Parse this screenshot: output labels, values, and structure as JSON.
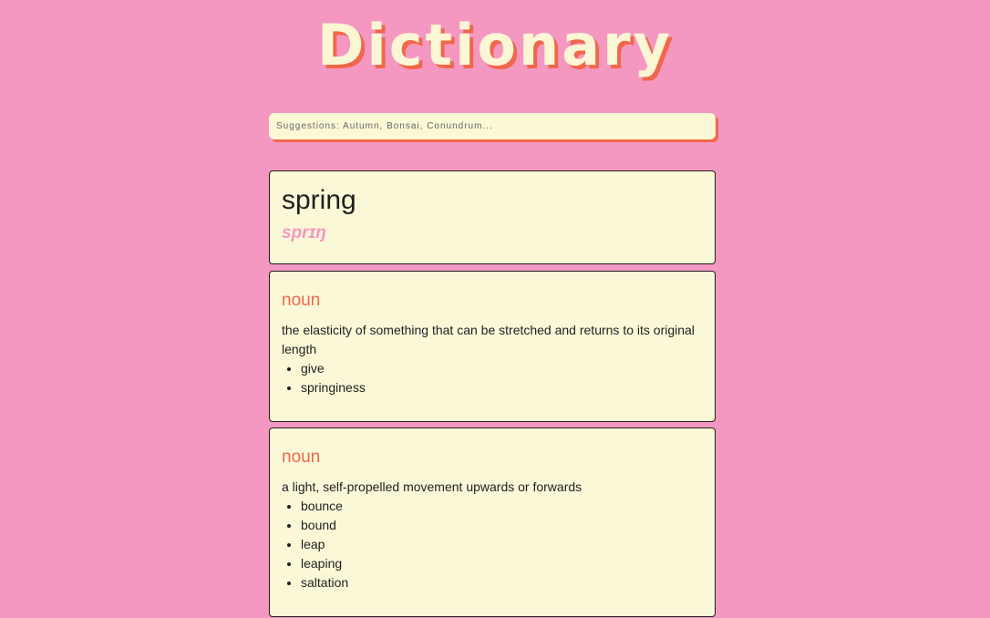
{
  "header": {
    "title": "Dictionary"
  },
  "search": {
    "placeholder": "Suggestions: Autumn, Bonsai, Conundrum..."
  },
  "entry": {
    "word": "spring",
    "phonetic": "sprɪŋ"
  },
  "meanings": [
    {
      "part_of_speech": "noun",
      "definition": "the elasticity of something that can be stretched and returns to its original length",
      "synonyms": [
        "give",
        "springiness"
      ]
    },
    {
      "part_of_speech": "noun",
      "definition": "a light, self-propelled movement upwards or forwards",
      "synonyms": [
        "bounce",
        "bound",
        "leap",
        "leaping",
        "saltation"
      ]
    }
  ],
  "colors": {
    "background": "#f498c2",
    "card": "#fbf8d8",
    "accent": "#f0674a",
    "title": "#fbf6d4"
  }
}
